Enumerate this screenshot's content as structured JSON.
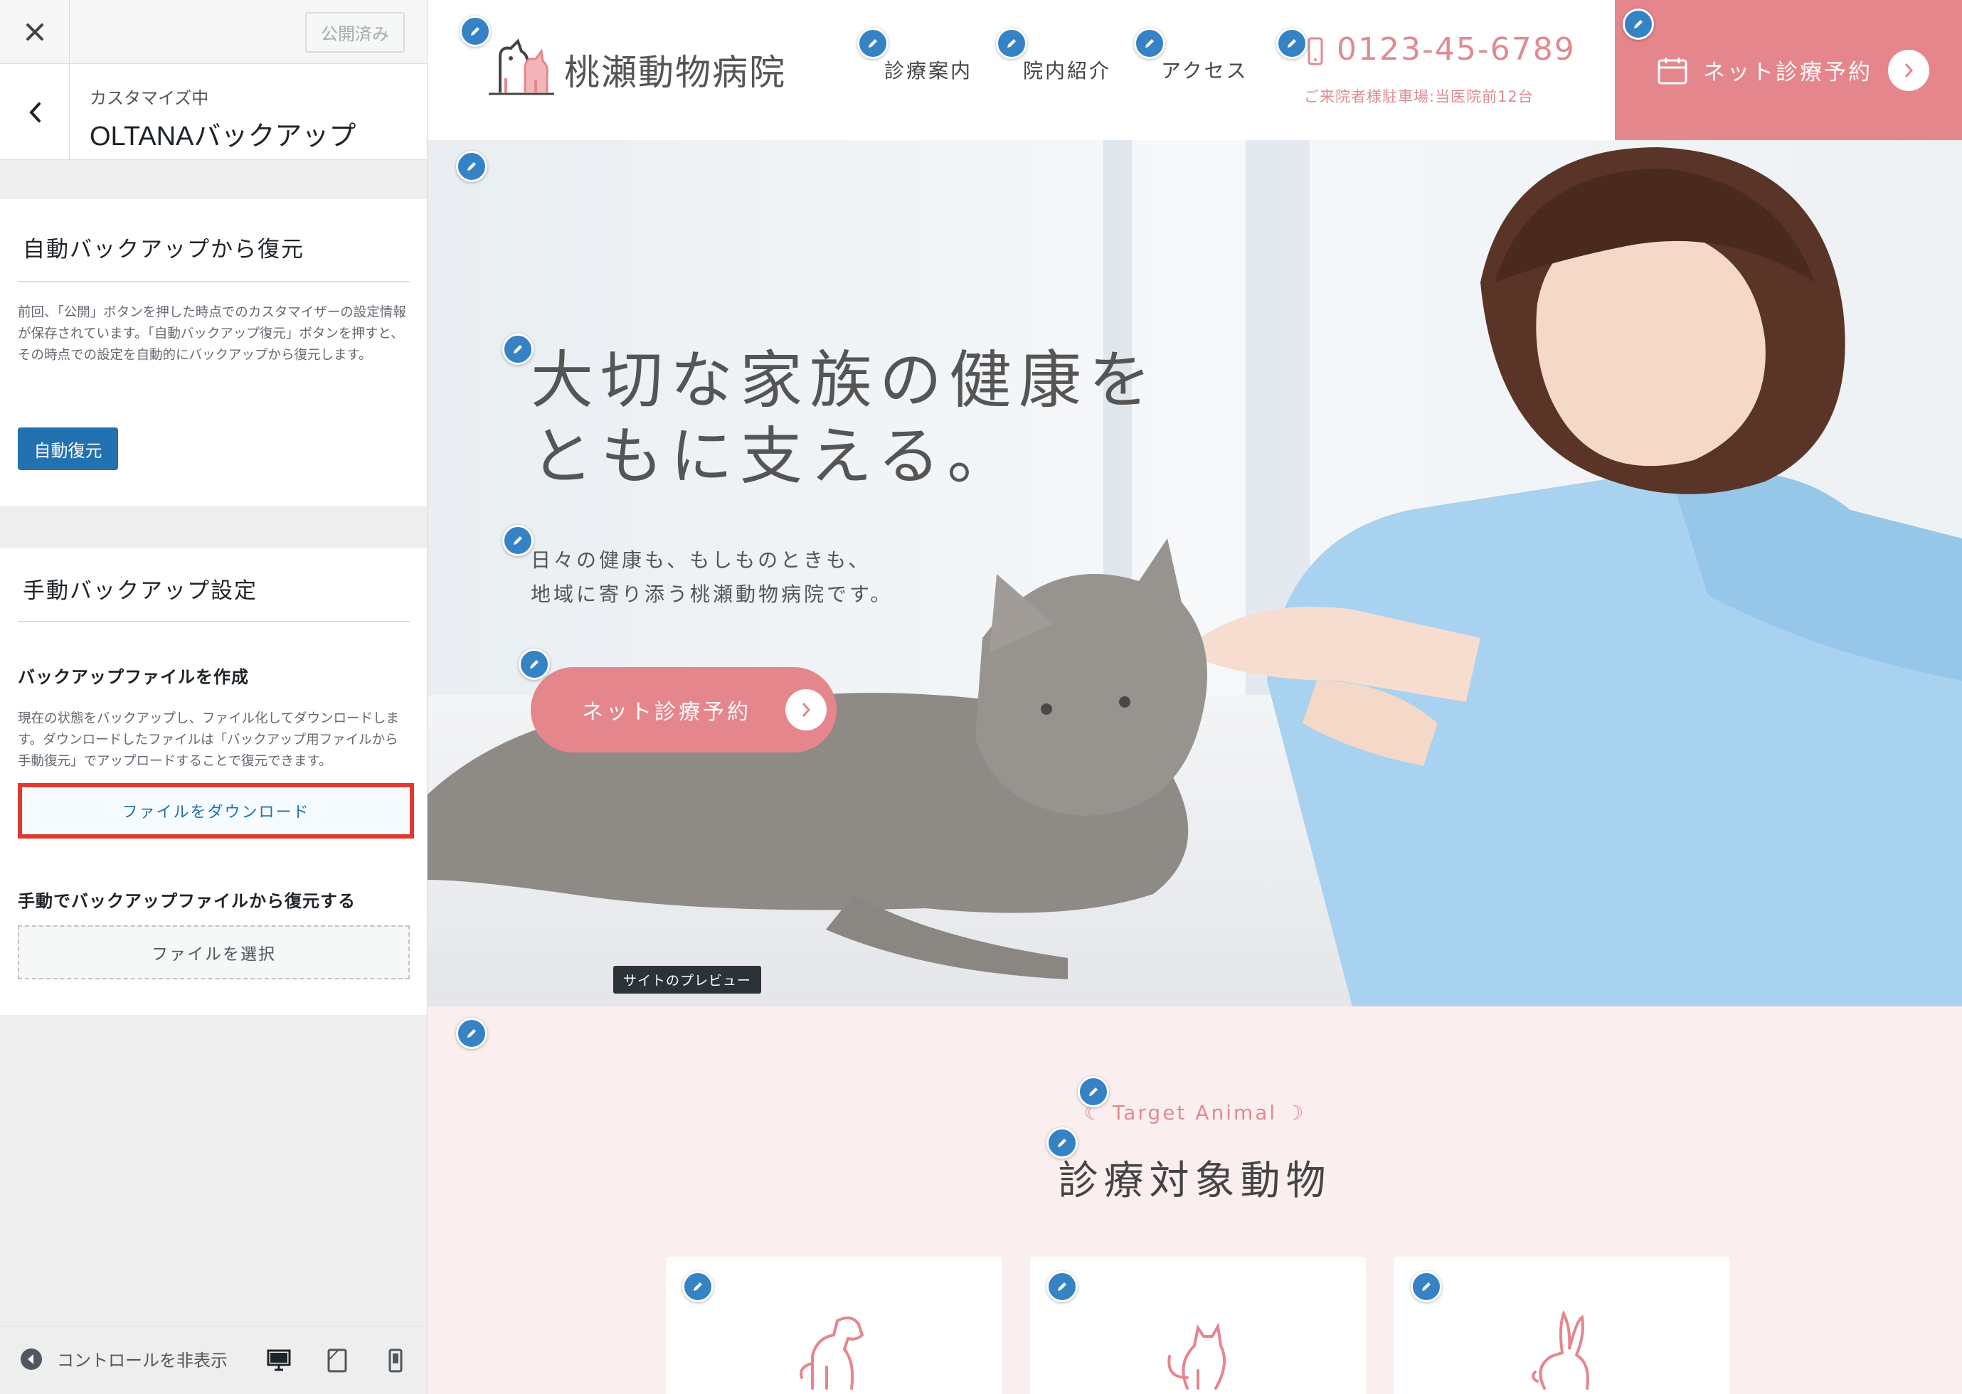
{
  "sidebar": {
    "close_icon": "close-icon",
    "publish_label": "公開済み",
    "customizing_label": "カスタマイズ中",
    "section_title": "OLTANAバックアップ",
    "auto_panel": {
      "title": "自動バックアップから復元",
      "description": "前回、「公開」ボタンを押した時点でのカスタマイザーの設定情報が保存されています。「自動バックアップ復元」ボタンを押すと、その時点での設定を自動的にバックアップから復元します。",
      "button": "自動復元"
    },
    "manual_panel": {
      "title": "手動バックアップ設定",
      "create_label": "バックアップファイルを作成",
      "create_description": "現在の状態をバックアップし、ファイル化してダウンロードします。ダウンロードしたファイルは「バックアップ用ファイルから手動復元」でアップロードすることで復元できます。",
      "download_button": "ファイルをダウンロード",
      "restore_label": "手動でバックアップファイルから復元する",
      "select_button": "ファイルを選択"
    },
    "footer": {
      "hide_controls": "コントロールを非表示"
    }
  },
  "preview": {
    "logo_name": "桃瀬動物病院",
    "nav": [
      "診療案内",
      "院内紹介",
      "アクセス"
    ],
    "phone": "0123-45-6789",
    "parking": "ご来院者様駐車場:当医院前12台",
    "header_reserve": "ネット診療予約",
    "hero_title_line1": "大切な家族の健康を",
    "hero_title_line2": "ともに支える。",
    "hero_sub_line1": "日々の健康も、もしものときも、",
    "hero_sub_line2": "地域に寄り添う桃瀬動物病院です。",
    "hero_reserve": "ネット診療予約",
    "tooltip": "サイトのプレビュー",
    "target_en": "☾ Target Animal ☽",
    "target_ja": "診療対象動物",
    "animals": [
      "dog-icon",
      "cat-icon",
      "rabbit-icon"
    ]
  },
  "colors": {
    "accent_pink": "#e5868c",
    "wp_blue": "#2271b1",
    "highlight_red": "#e03a2f",
    "section_bg": "#fbeeef"
  }
}
